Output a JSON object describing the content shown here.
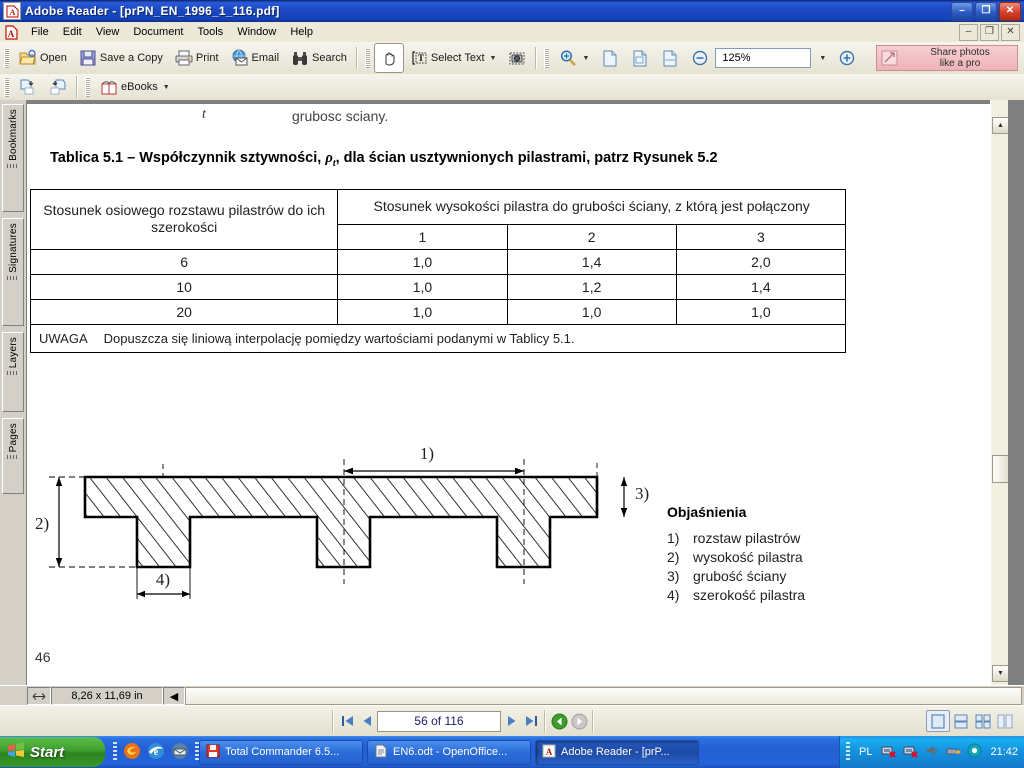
{
  "window": {
    "title": "Adobe Reader - [prPN_EN_1996_1_116.pdf]",
    "app_icon": "adobe-reader-icon",
    "minimize": "–",
    "restore": "❐",
    "close": "✕",
    "child_minimize": "–",
    "child_restore": "❐",
    "child_close": "✕"
  },
  "menu": {
    "items": [
      {
        "label": "File"
      },
      {
        "label": "Edit"
      },
      {
        "label": "View"
      },
      {
        "label": "Document"
      },
      {
        "label": "Tools"
      },
      {
        "label": "Window"
      },
      {
        "label": "Help"
      }
    ]
  },
  "toolbar_main": {
    "open": "Open",
    "save_a_copy": "Save a Copy",
    "print": "Print",
    "email": "Email",
    "search": "Search",
    "select_text": "Select Text",
    "zoom_value": "125%",
    "share_line1": "Share photos",
    "share_line2": "like a pro"
  },
  "toolbar_secondary": {
    "ebooks": "eBooks"
  },
  "navpane": {
    "tabs": [
      {
        "label": "Bookmarks"
      },
      {
        "label": "Signatures"
      },
      {
        "label": "Layers"
      },
      {
        "label": "Pages"
      }
    ]
  },
  "document": {
    "symbol_t": "t",
    "symbol_t_desc": "grubosc sciany.",
    "caption_pre": "Tablica 5.1 – Współczynnik sztywności, ",
    "caption_rho": "ρ",
    "caption_sub": "t",
    "caption_post": ", dla ścian usztywnionych pilastrami, patrz Rysunek 5.2",
    "page_number": "46",
    "table": {
      "header_col1": "Stosunek osiowego rozstawu pilastrów do ich szerokości",
      "header_col2": "Stosunek wysokości pilastra do grubości ściany, z którą jest połączony",
      "subheaders": [
        "1",
        "2",
        "3"
      ],
      "rows": [
        {
          "ratio": "6",
          "values": [
            "1,0",
            "1,4",
            "2,0"
          ]
        },
        {
          "ratio": "10",
          "values": [
            "1,0",
            "1,2",
            "1,4"
          ]
        },
        {
          "ratio": "20",
          "values": [
            "1,0",
            "1,0",
            "1,0"
          ]
        }
      ],
      "note_label": "UWAGA",
      "note_text": "Dopuszcza się liniową interpolację pomiędzy wartościami podanymi w Tablicy 5.1."
    },
    "figure": {
      "labels": {
        "one": "1)",
        "two": "2)",
        "three": "3)",
        "four": "4)"
      }
    },
    "legend": {
      "title": "Objaśnienia",
      "items": [
        {
          "num": "1)",
          "text": "rozstaw pilastrów"
        },
        {
          "num": "2)",
          "text": "wysokość pilastra"
        },
        {
          "num": "3)",
          "text": "grubość ściany"
        },
        {
          "num": "4)",
          "text": "szerokość pilastra"
        }
      ]
    }
  },
  "statusbar": {
    "page_size": "8,26 x 11,69 in"
  },
  "navbar": {
    "page_indicator": "56 of 116"
  },
  "taskbar": {
    "start": "Start",
    "buttons": [
      {
        "label": "Total Commander 6.5...",
        "icon": "floppy-icon"
      },
      {
        "label": "EN6.odt - OpenOffice...",
        "icon": "document-icon"
      },
      {
        "label": "Adobe Reader - [prP...",
        "icon": "adobe-reader-icon"
      }
    ],
    "language": "PL",
    "clock": "21:42"
  },
  "colors": {
    "titlebar_blue": "#1c48c0",
    "taskbar_blue": "#2363d8",
    "start_green": "#3f9e2e",
    "share_pink": "#eeb3b8",
    "toolbar_bg": "#ece9d8"
  }
}
